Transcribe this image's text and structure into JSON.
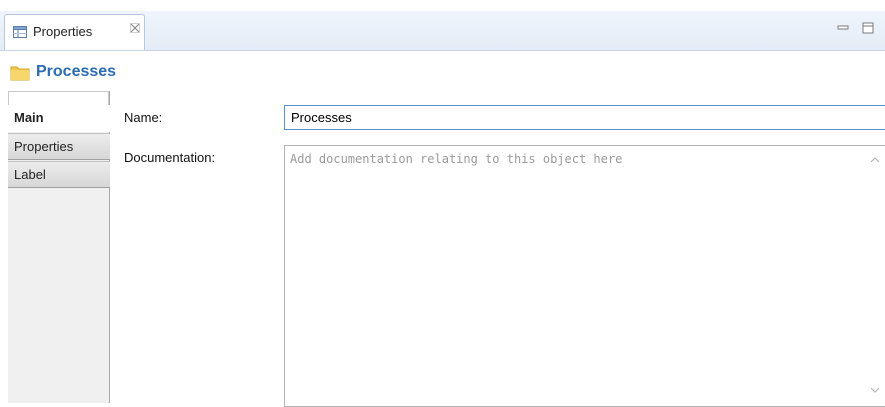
{
  "view_tab": {
    "label": "Properties",
    "icon": "properties-table-icon",
    "close_icon": "close-icon"
  },
  "window_controls": {
    "minimize_icon": "minimize-icon",
    "maximize_icon": "maximize-icon"
  },
  "header": {
    "title": "Processes",
    "icon": "folder-icon",
    "title_color": "#2a6bb4"
  },
  "side_tabs": [
    {
      "label": "Main",
      "active": true
    },
    {
      "label": "Properties",
      "active": false
    },
    {
      "label": "Label",
      "active": false
    }
  ],
  "form": {
    "name_label": "Name:",
    "name_value": "Processes",
    "documentation_label": "Documentation:",
    "documentation_placeholder": "Add documentation relating to this object here"
  },
  "colors": {
    "accent": "#2a6bb4",
    "focus_border": "#5a8ed0",
    "folder": "#f2c94c"
  }
}
